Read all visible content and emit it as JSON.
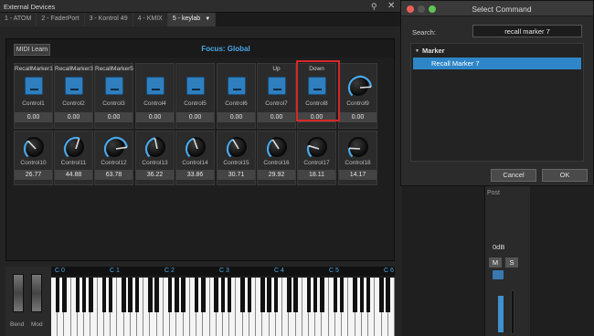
{
  "external_devices": {
    "title": "External Devices",
    "tabs": [
      {
        "label": "1 - ATOM"
      },
      {
        "label": "2 - FaderPort"
      },
      {
        "label": "3 - Kontrol 49"
      },
      {
        "label": "4 - KMIX"
      },
      {
        "label": "5 - keylab",
        "active": true
      }
    ],
    "midi_learn": "MIDI Learn",
    "focus": "Focus: Global",
    "top_row": [
      {
        "label": "RecallMarker1",
        "control": "Control1",
        "value": "0.00",
        "type": "button"
      },
      {
        "label": "RecallMarker3",
        "control": "Control2",
        "value": "0.00",
        "type": "button"
      },
      {
        "label": "RecallMarker5",
        "control": "Control3",
        "value": "0.00",
        "type": "button"
      },
      {
        "label": "",
        "control": "Control4",
        "value": "0.00",
        "type": "button"
      },
      {
        "label": "",
        "control": "Control5",
        "value": "0.00",
        "type": "button"
      },
      {
        "label": "",
        "control": "Control6",
        "value": "0.00",
        "type": "button"
      },
      {
        "label": "Up",
        "control": "Control7",
        "value": "0.00",
        "type": "button"
      },
      {
        "label": "Down",
        "control": "Control8",
        "value": "0.00",
        "type": "button"
      },
      {
        "label": "",
        "control": "Control9",
        "value": "0.00",
        "type": "knob"
      }
    ],
    "bottom_row": [
      {
        "control": "Control10",
        "value": "26.77"
      },
      {
        "control": "Control11",
        "value": "44.88"
      },
      {
        "control": "Control12",
        "value": "63.78"
      },
      {
        "control": "Control13",
        "value": "36.22"
      },
      {
        "control": "Control14",
        "value": "33.86"
      },
      {
        "control": "Control15",
        "value": "30.71"
      },
      {
        "control": "Control16",
        "value": "29.92"
      },
      {
        "control": "Control17",
        "value": "18.11"
      },
      {
        "control": "Control18",
        "value": "14.17"
      }
    ],
    "keyboard": {
      "octaves": [
        "C 0",
        "C 1",
        "C 2",
        "C 3",
        "C 4",
        "C 5",
        "C 6"
      ],
      "bend_label": "Bend",
      "mod_label": "Mod"
    }
  },
  "select_command": {
    "title": "Select Command",
    "search_label": "Search:",
    "search_value": "recall marker 7",
    "group": "Marker",
    "result": "Recall Marker 7",
    "cancel": "Cancel",
    "ok": "OK"
  },
  "mixer": {
    "post": "Post",
    "gain": "0dB",
    "mute": "M",
    "solo": "S"
  },
  "colors": {
    "accent": "#2e86c8",
    "highlight": "#d6282a",
    "focus_text": "#4aa8e8"
  }
}
